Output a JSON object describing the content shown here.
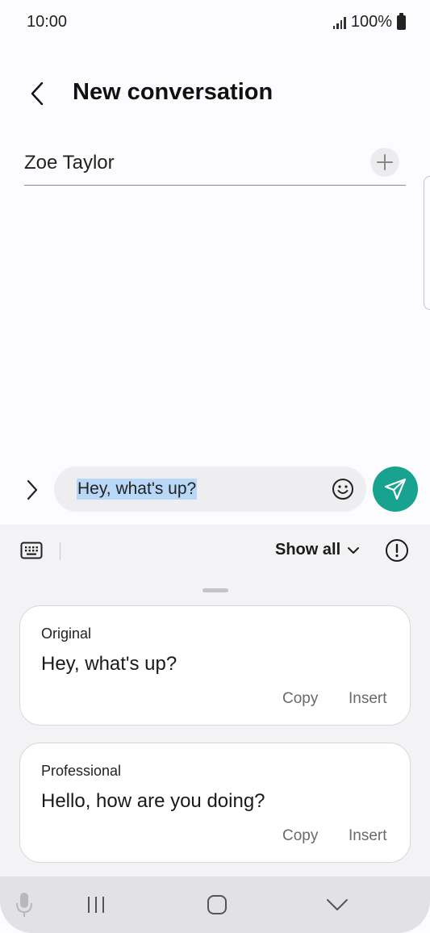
{
  "status_bar": {
    "time": "10:00",
    "battery": "100%"
  },
  "header": {
    "title": "New conversation",
    "back_icon": "chevron-left-icon"
  },
  "recipient": {
    "name": "Zoe Taylor",
    "add_icon": "plus-icon"
  },
  "compose": {
    "message": "Hey, what's up?",
    "expand_icon": "chevron-right-icon",
    "emoji_icon": "smiley-icon",
    "send_icon": "send-icon",
    "send_color": "#17a390",
    "selection_color": "#b9d8f7"
  },
  "ai_panel": {
    "show_all_label": "Show all",
    "keyboard_icon": "keyboard-icon",
    "info_icon": "info-icon",
    "suggestions": [
      {
        "label": "Original",
        "text": "Hey, what's up?",
        "copy": "Copy",
        "insert": "Insert"
      },
      {
        "label": "Professional",
        "text": "Hello, how are you doing?",
        "copy": "Copy",
        "insert": "Insert"
      }
    ]
  },
  "nav_bar": {
    "icons": [
      "mic-icon",
      "recents-icon",
      "home-icon",
      "hide-keyboard-icon"
    ]
  }
}
